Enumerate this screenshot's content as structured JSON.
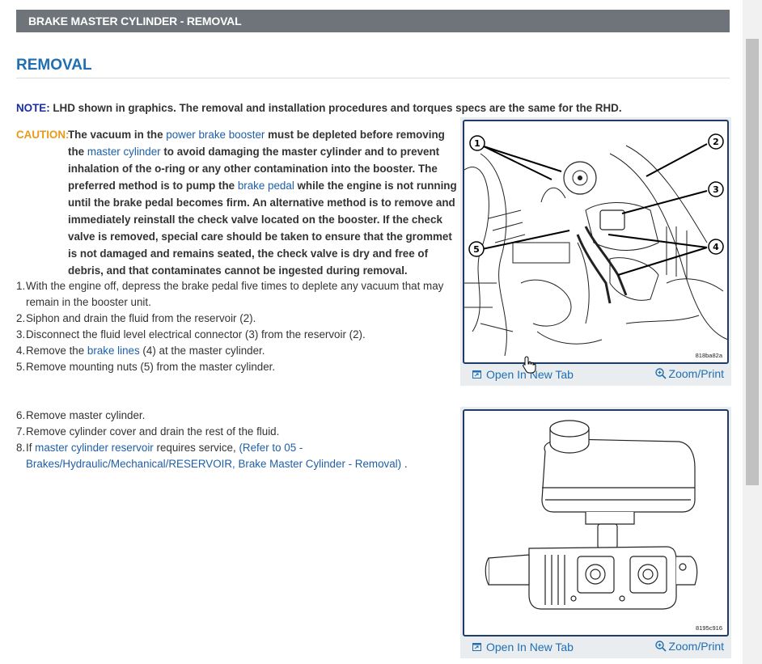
{
  "header": {
    "title": "BRAKE MASTER CYLINDER - REMOVAL"
  },
  "section": {
    "title": "REMOVAL"
  },
  "note": {
    "label": "NOTE:",
    "text": " LHD shown in graphics. The removal and installation procedures and torques specs are the same for the RHD."
  },
  "caution": {
    "label": "CAUTION:",
    "t1": "The vacuum in the ",
    "l1": "power brake booster",
    "t2": " must be depleted before removing the ",
    "l2": "master cylinder",
    "t3": " to avoid damaging the master cylinder and to prevent inhalation of the o-ring or any other contamination into the booster. The preferred method is to pump the ",
    "l3": "brake pedal",
    "t4": " while the engine is not running until the brake pedal becomes firm. An alternative method is to remove and immediately reinstall the check valve located on the booster. If the check valve is removed, special care should be taken to ensure that the grommet is not damaged and remains seated, the check valve is dry and free of debris, and that contaminates cannot be ingested during removal."
  },
  "steps": {
    "s1": {
      "num": "1.",
      "text": "With the engine off, depress the brake pedal five times to deplete any vacuum that may remain in the booster unit."
    },
    "s2": {
      "num": "2.",
      "text": "Siphon and drain the fluid from the reservoir (2)."
    },
    "s3": {
      "num": "3.",
      "text": "Disconnect the fluid level electrical connector (3) from the reservoir (2)."
    },
    "s4": {
      "num": "4.",
      "pre": "Remove the ",
      "link": "brake lines",
      "post": " (4) at the master cylinder."
    },
    "s5": {
      "num": "5.",
      "text": "Remove mounting nuts (5) from the master cylinder."
    },
    "s6": {
      "num": "6.",
      "text": "Remove master cylinder."
    },
    "s7": {
      "num": "7.",
      "text": "Remove cylinder cover and drain the rest of the fluid."
    },
    "s8": {
      "num": "8.",
      "pre": "If ",
      "link": "master cylinder reservoir",
      "mid": " requires service, ",
      "ref": "(Refer to 05 - Brakes/Hydraulic/Mechanical/RESERVOIR, Brake Master Cylinder - Removal)",
      "post": " ."
    }
  },
  "figures": {
    "f1": {
      "id": "818ba82a",
      "callouts": [
        "1",
        "2",
        "3",
        "4",
        "5"
      ],
      "open_label": "Open In New Tab",
      "zoom_label": "Zoom/Print"
    },
    "f2": {
      "id": "8195c916",
      "open_label": "Open In New Tab",
      "zoom_label": "Zoom/Print"
    }
  },
  "colors": {
    "header_bg": "#6e7479",
    "title_blue": "#1f6fb2",
    "note_blue": "#1a2ea8",
    "caution_orange": "#e79b1b",
    "link_blue": "#1f5fa6",
    "figure_border": "#1f3d66"
  }
}
